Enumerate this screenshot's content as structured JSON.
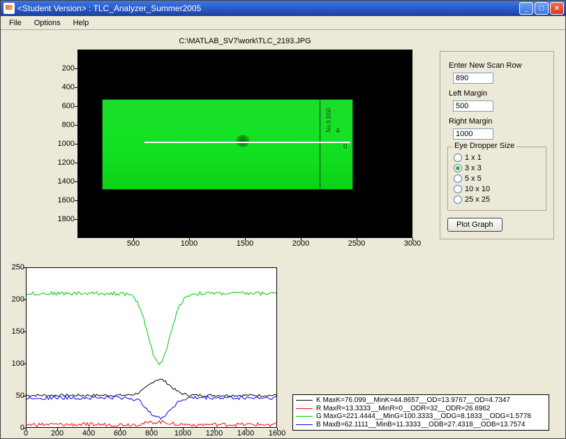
{
  "window": {
    "title": "<Student Version> : TLC_Analyzer_Summer2005"
  },
  "menu": {
    "file": "File",
    "options": "Options",
    "help": "Help"
  },
  "image_panel": {
    "title": "C:\\MATLAB_SV7\\work\\TLC_2193.JPG",
    "y_ticks": [
      "200",
      "400",
      "600",
      "800",
      "1000",
      "1200",
      "1400",
      "1600",
      "1800"
    ],
    "x_ticks": [
      "500",
      "1000",
      "1500",
      "2000",
      "2500",
      "3000"
    ]
  },
  "controls": {
    "scan_row_label": "Enter New Scan Row",
    "scan_row_value": "890",
    "left_margin_label": "Left Margin",
    "left_margin_value": "500",
    "right_margin_label": "Right Margin",
    "right_margin_value": "1000",
    "eye_dropper_legend": "Eye Dropper Size",
    "eye_dropper_options": [
      "1 x 1",
      "3 x 3",
      "5 x 5",
      "10 x 10",
      "25 x 25"
    ],
    "eye_dropper_selected_index": 1,
    "plot_button": "Plot Graph"
  },
  "plot": {
    "y_ticks": [
      "0",
      "50",
      "100",
      "150",
      "200",
      "250"
    ],
    "x_ticks": [
      "0",
      "200",
      "400",
      "600",
      "800",
      "1000",
      "1200",
      "1400",
      "1600"
    ]
  },
  "chart_data": {
    "type": "line",
    "xlabel": "",
    "ylabel": "",
    "xlim": [
      0,
      1600
    ],
    "ylim": [
      0,
      250
    ],
    "series": [
      {
        "name": "K",
        "color": "#000000",
        "baseline": 50,
        "dip_x": 850,
        "dip_value": 75,
        "dip_direction": "up",
        "noise": 2
      },
      {
        "name": "R",
        "color": "#ff0000",
        "baseline": 4,
        "dip_x": 850,
        "dip_value": 8,
        "dip_direction": "up",
        "noise": 3
      },
      {
        "name": "G",
        "color": "#00c800",
        "baseline": 210,
        "dip_x": 850,
        "dip_value": 100,
        "dip_direction": "down",
        "noise": 3
      },
      {
        "name": "B",
        "color": "#0000ff",
        "baseline": 46,
        "dip_x": 850,
        "dip_value": 15,
        "dip_direction": "down",
        "noise": 3
      }
    ]
  },
  "legend": {
    "entries": [
      {
        "color": "#000000",
        "text": "K   MaxK=76.099__MinK=44.8657__OD=13.9767__OD=4.7347"
      },
      {
        "color": "#ff0000",
        "text": "R   MaxR=13.3333__MinR=0__ODR=32__ODR=26.6962"
      },
      {
        "color": "#00c800",
        "text": "G   MaxG=221.4444__MinG=100.3333__ODG=8.1833__ODG=1.5778"
      },
      {
        "color": "#0000ff",
        "text": "B   MaxB=62.1111__MinB=11.3333__ODB=27.4318__ODB=13.7574"
      }
    ]
  }
}
